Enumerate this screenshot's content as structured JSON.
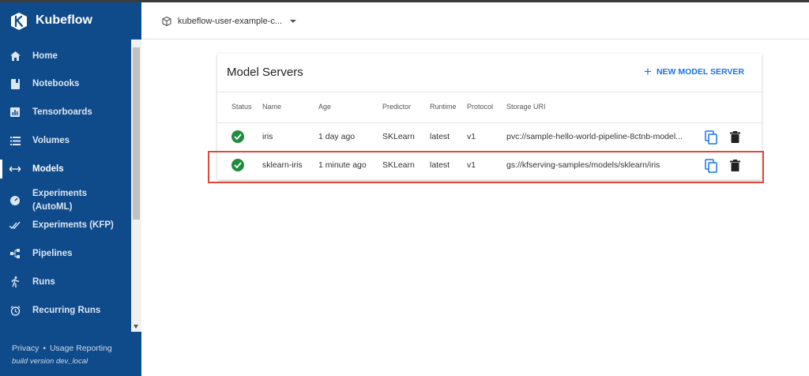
{
  "app": {
    "title": "Kubeflow"
  },
  "sidebar": {
    "items": [
      {
        "label": "Home",
        "icon": "home-icon",
        "active": false
      },
      {
        "label": "Notebooks",
        "icon": "book-icon",
        "active": false
      },
      {
        "label": "Tensorboards",
        "icon": "chart-icon",
        "active": false
      },
      {
        "label": "Volumes",
        "icon": "list-icon",
        "active": false
      },
      {
        "label": "Models",
        "icon": "arrows-icon",
        "active": true
      },
      {
        "label": "Experiments\n(AutoML)",
        "icon": "speed-icon",
        "active": false
      },
      {
        "label": "Experiments (KFP)",
        "icon": "check-icon",
        "active": false
      },
      {
        "label": "Pipelines",
        "icon": "pipeline-icon",
        "active": false
      },
      {
        "label": "Runs",
        "icon": "run-icon",
        "active": false
      },
      {
        "label": "Recurring Runs",
        "icon": "alarm-icon",
        "active": false
      }
    ],
    "footer": {
      "privacy": "Privacy",
      "dot": "•",
      "usage": "Usage Reporting",
      "build": "build version dev_local"
    }
  },
  "topbar": {
    "namespace": "kubeflow-user-example-c..."
  },
  "card": {
    "title": "Model Servers",
    "new_button": "NEW MODEL SERVER",
    "columns": [
      "Status",
      "Name",
      "Age",
      "Predictor",
      "Runtime",
      "Protocol",
      "Storage URI"
    ],
    "rows": [
      {
        "status": "ready",
        "name": "iris",
        "age": "1 day ago",
        "predictor": "SKLearn",
        "runtime": "latest",
        "protocol": "v1",
        "uri": "pvc://sample-hello-world-pipeline-8ctnb-model..."
      },
      {
        "status": "ready",
        "name": "sklearn-iris",
        "age": "1 minute ago",
        "predictor": "SKLearn",
        "runtime": "latest",
        "protocol": "v1",
        "uri": "gs://kfserving-samples/models/sklearn/iris"
      }
    ]
  },
  "colors": {
    "sidebar": "#0f4a8a",
    "accent": "#1a73e8",
    "status_ok": "#1e8e3e",
    "highlight": "#e0483a"
  }
}
